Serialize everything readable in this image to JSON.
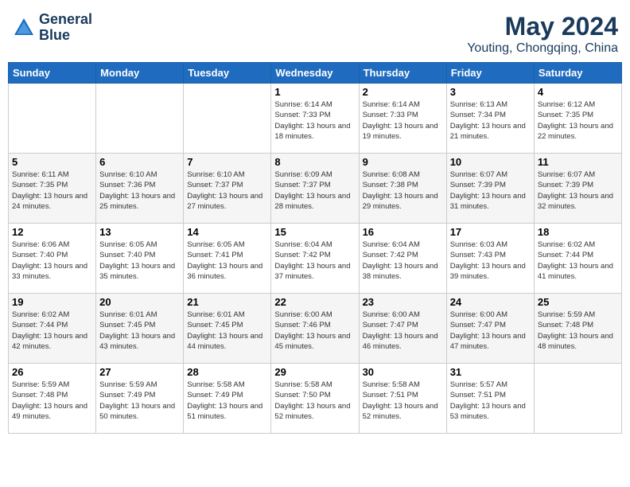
{
  "header": {
    "logo_line1": "General",
    "logo_line2": "Blue",
    "month": "May 2024",
    "location": "Youting, Chongqing, China"
  },
  "weekdays": [
    "Sunday",
    "Monday",
    "Tuesday",
    "Wednesday",
    "Thursday",
    "Friday",
    "Saturday"
  ],
  "weeks": [
    [
      {
        "day": "",
        "sunrise": "",
        "sunset": "",
        "daylight": ""
      },
      {
        "day": "",
        "sunrise": "",
        "sunset": "",
        "daylight": ""
      },
      {
        "day": "",
        "sunrise": "",
        "sunset": "",
        "daylight": ""
      },
      {
        "day": "1",
        "sunrise": "Sunrise: 6:14 AM",
        "sunset": "Sunset: 7:33 PM",
        "daylight": "Daylight: 13 hours and 18 minutes."
      },
      {
        "day": "2",
        "sunrise": "Sunrise: 6:14 AM",
        "sunset": "Sunset: 7:33 PM",
        "daylight": "Daylight: 13 hours and 19 minutes."
      },
      {
        "day": "3",
        "sunrise": "Sunrise: 6:13 AM",
        "sunset": "Sunset: 7:34 PM",
        "daylight": "Daylight: 13 hours and 21 minutes."
      },
      {
        "day": "4",
        "sunrise": "Sunrise: 6:12 AM",
        "sunset": "Sunset: 7:35 PM",
        "daylight": "Daylight: 13 hours and 22 minutes."
      }
    ],
    [
      {
        "day": "5",
        "sunrise": "Sunrise: 6:11 AM",
        "sunset": "Sunset: 7:35 PM",
        "daylight": "Daylight: 13 hours and 24 minutes."
      },
      {
        "day": "6",
        "sunrise": "Sunrise: 6:10 AM",
        "sunset": "Sunset: 7:36 PM",
        "daylight": "Daylight: 13 hours and 25 minutes."
      },
      {
        "day": "7",
        "sunrise": "Sunrise: 6:10 AM",
        "sunset": "Sunset: 7:37 PM",
        "daylight": "Daylight: 13 hours and 27 minutes."
      },
      {
        "day": "8",
        "sunrise": "Sunrise: 6:09 AM",
        "sunset": "Sunset: 7:37 PM",
        "daylight": "Daylight: 13 hours and 28 minutes."
      },
      {
        "day": "9",
        "sunrise": "Sunrise: 6:08 AM",
        "sunset": "Sunset: 7:38 PM",
        "daylight": "Daylight: 13 hours and 29 minutes."
      },
      {
        "day": "10",
        "sunrise": "Sunrise: 6:07 AM",
        "sunset": "Sunset: 7:39 PM",
        "daylight": "Daylight: 13 hours and 31 minutes."
      },
      {
        "day": "11",
        "sunrise": "Sunrise: 6:07 AM",
        "sunset": "Sunset: 7:39 PM",
        "daylight": "Daylight: 13 hours and 32 minutes."
      }
    ],
    [
      {
        "day": "12",
        "sunrise": "Sunrise: 6:06 AM",
        "sunset": "Sunset: 7:40 PM",
        "daylight": "Daylight: 13 hours and 33 minutes."
      },
      {
        "day": "13",
        "sunrise": "Sunrise: 6:05 AM",
        "sunset": "Sunset: 7:40 PM",
        "daylight": "Daylight: 13 hours and 35 minutes."
      },
      {
        "day": "14",
        "sunrise": "Sunrise: 6:05 AM",
        "sunset": "Sunset: 7:41 PM",
        "daylight": "Daylight: 13 hours and 36 minutes."
      },
      {
        "day": "15",
        "sunrise": "Sunrise: 6:04 AM",
        "sunset": "Sunset: 7:42 PM",
        "daylight": "Daylight: 13 hours and 37 minutes."
      },
      {
        "day": "16",
        "sunrise": "Sunrise: 6:04 AM",
        "sunset": "Sunset: 7:42 PM",
        "daylight": "Daylight: 13 hours and 38 minutes."
      },
      {
        "day": "17",
        "sunrise": "Sunrise: 6:03 AM",
        "sunset": "Sunset: 7:43 PM",
        "daylight": "Daylight: 13 hours and 39 minutes."
      },
      {
        "day": "18",
        "sunrise": "Sunrise: 6:02 AM",
        "sunset": "Sunset: 7:44 PM",
        "daylight": "Daylight: 13 hours and 41 minutes."
      }
    ],
    [
      {
        "day": "19",
        "sunrise": "Sunrise: 6:02 AM",
        "sunset": "Sunset: 7:44 PM",
        "daylight": "Daylight: 13 hours and 42 minutes."
      },
      {
        "day": "20",
        "sunrise": "Sunrise: 6:01 AM",
        "sunset": "Sunset: 7:45 PM",
        "daylight": "Daylight: 13 hours and 43 minutes."
      },
      {
        "day": "21",
        "sunrise": "Sunrise: 6:01 AM",
        "sunset": "Sunset: 7:45 PM",
        "daylight": "Daylight: 13 hours and 44 minutes."
      },
      {
        "day": "22",
        "sunrise": "Sunrise: 6:00 AM",
        "sunset": "Sunset: 7:46 PM",
        "daylight": "Daylight: 13 hours and 45 minutes."
      },
      {
        "day": "23",
        "sunrise": "Sunrise: 6:00 AM",
        "sunset": "Sunset: 7:47 PM",
        "daylight": "Daylight: 13 hours and 46 minutes."
      },
      {
        "day": "24",
        "sunrise": "Sunrise: 6:00 AM",
        "sunset": "Sunset: 7:47 PM",
        "daylight": "Daylight: 13 hours and 47 minutes."
      },
      {
        "day": "25",
        "sunrise": "Sunrise: 5:59 AM",
        "sunset": "Sunset: 7:48 PM",
        "daylight": "Daylight: 13 hours and 48 minutes."
      }
    ],
    [
      {
        "day": "26",
        "sunrise": "Sunrise: 5:59 AM",
        "sunset": "Sunset: 7:48 PM",
        "daylight": "Daylight: 13 hours and 49 minutes."
      },
      {
        "day": "27",
        "sunrise": "Sunrise: 5:59 AM",
        "sunset": "Sunset: 7:49 PM",
        "daylight": "Daylight: 13 hours and 50 minutes."
      },
      {
        "day": "28",
        "sunrise": "Sunrise: 5:58 AM",
        "sunset": "Sunset: 7:49 PM",
        "daylight": "Daylight: 13 hours and 51 minutes."
      },
      {
        "day": "29",
        "sunrise": "Sunrise: 5:58 AM",
        "sunset": "Sunset: 7:50 PM",
        "daylight": "Daylight: 13 hours and 52 minutes."
      },
      {
        "day": "30",
        "sunrise": "Sunrise: 5:58 AM",
        "sunset": "Sunset: 7:51 PM",
        "daylight": "Daylight: 13 hours and 52 minutes."
      },
      {
        "day": "31",
        "sunrise": "Sunrise: 5:57 AM",
        "sunset": "Sunset: 7:51 PM",
        "daylight": "Daylight: 13 hours and 53 minutes."
      },
      {
        "day": "",
        "sunrise": "",
        "sunset": "",
        "daylight": ""
      }
    ]
  ]
}
